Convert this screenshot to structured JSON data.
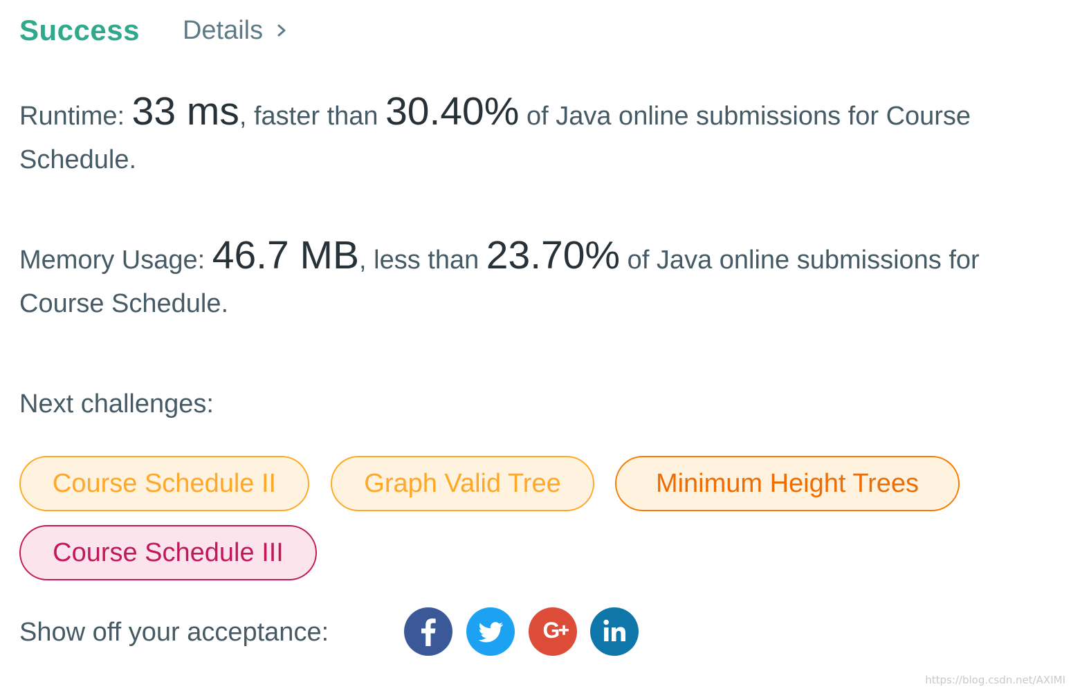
{
  "header": {
    "status": "Success",
    "details_label": "Details",
    "status_color": "#2fa88c"
  },
  "runtime": {
    "label": "Runtime: ",
    "value": "33 ms",
    "comparison": ", faster than ",
    "percent": "30.40%",
    "suffix": " of Java online submissions for Course Schedule."
  },
  "memory": {
    "label": "Memory Usage: ",
    "value": "46.7 MB",
    "comparison": ", less than ",
    "percent": "23.70%",
    "suffix": " of Java online submissions for Course Schedule."
  },
  "next_challenges": {
    "label": "Next challenges:",
    "items": [
      {
        "title": "Course Schedule II",
        "difficulty_color": "#ffa726"
      },
      {
        "title": "Graph Valid Tree",
        "difficulty_color": "#ffa726"
      },
      {
        "title": "Minimum Height Trees",
        "difficulty_color": "#f57c00"
      },
      {
        "title": "Course Schedule III",
        "difficulty_color": "#c2185b"
      }
    ]
  },
  "share": {
    "label": "Show off your acceptance:",
    "networks": [
      {
        "icon": "facebook-icon",
        "color": "#3b5998"
      },
      {
        "icon": "twitter-icon",
        "color": "#1da1f2"
      },
      {
        "icon": "google-plus-icon",
        "color": "#dd4b39"
      },
      {
        "icon": "linkedin-icon",
        "color": "#0e76a8"
      }
    ]
  },
  "watermark": "https://blog.csdn.net/AXIMI"
}
